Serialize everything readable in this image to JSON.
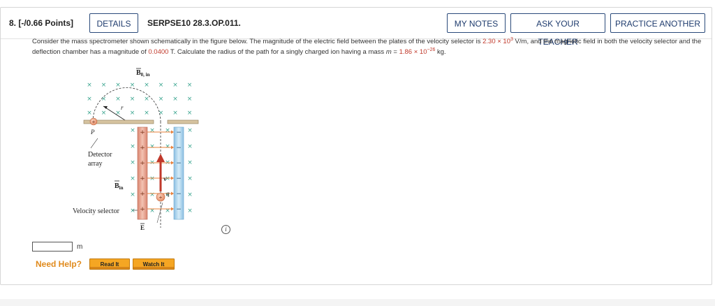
{
  "header": {
    "question_number": "8. [-/0.66 Points]",
    "details_label": "DETAILS",
    "question_id": "SERPSE10 28.3.OP.011.",
    "my_notes_label": "MY NOTES",
    "ask_teacher_label": "ASK YOUR TEACHER",
    "practice_label": "PRACTICE ANOTHER"
  },
  "problem": {
    "part1": "Consider the mass spectrometer shown schematically in the figure below. The magnitude of the electric field between the plates of the velocity selector is ",
    "e_field_mantissa": "2.30",
    "e_field_times": " × 10",
    "e_field_exp": "3",
    "part2": " V/m, and the magnetic field in both the velocity selector and the deflection chamber has a magnitude of ",
    "b_field": "0.0400",
    "part3": " T. Calculate the radius of the path for a singly charged ion having a mass ",
    "mass_var": "m",
    "mass_eq": " = ",
    "mass_mantissa": "1.86",
    "mass_times": " × 10",
    "mass_exp": "−26",
    "part4": " kg."
  },
  "figure": {
    "b0_label": "B",
    "b0_sub": "0, in",
    "r_label": "r",
    "p_label": "P",
    "detector_line1": "Detector",
    "detector_line2": "array",
    "bin_label": "B",
    "bin_sub": "in",
    "velocity_label": "Velocity selector",
    "v_label": "v",
    "q_label": "q",
    "e_label": "E",
    "cross_symbol": "×",
    "plus_symbol": "+",
    "minus_symbol": "−"
  },
  "answer": {
    "value": "",
    "unit": "m"
  },
  "help": {
    "need_help": "Need Help?",
    "read_it": "Read It",
    "watch_it": "Watch It"
  },
  "info_icon": "i",
  "colors": {
    "accent_blue": "#1f3c6e",
    "given_red": "#c0392b",
    "need_help_orange": "#e08a1c",
    "help_button": "#f5a623",
    "cross_green": "#3aa58f",
    "arrow_orange": "#e8803a",
    "plate_red": "#e39a86",
    "plate_blue": "#a8d0ea"
  }
}
